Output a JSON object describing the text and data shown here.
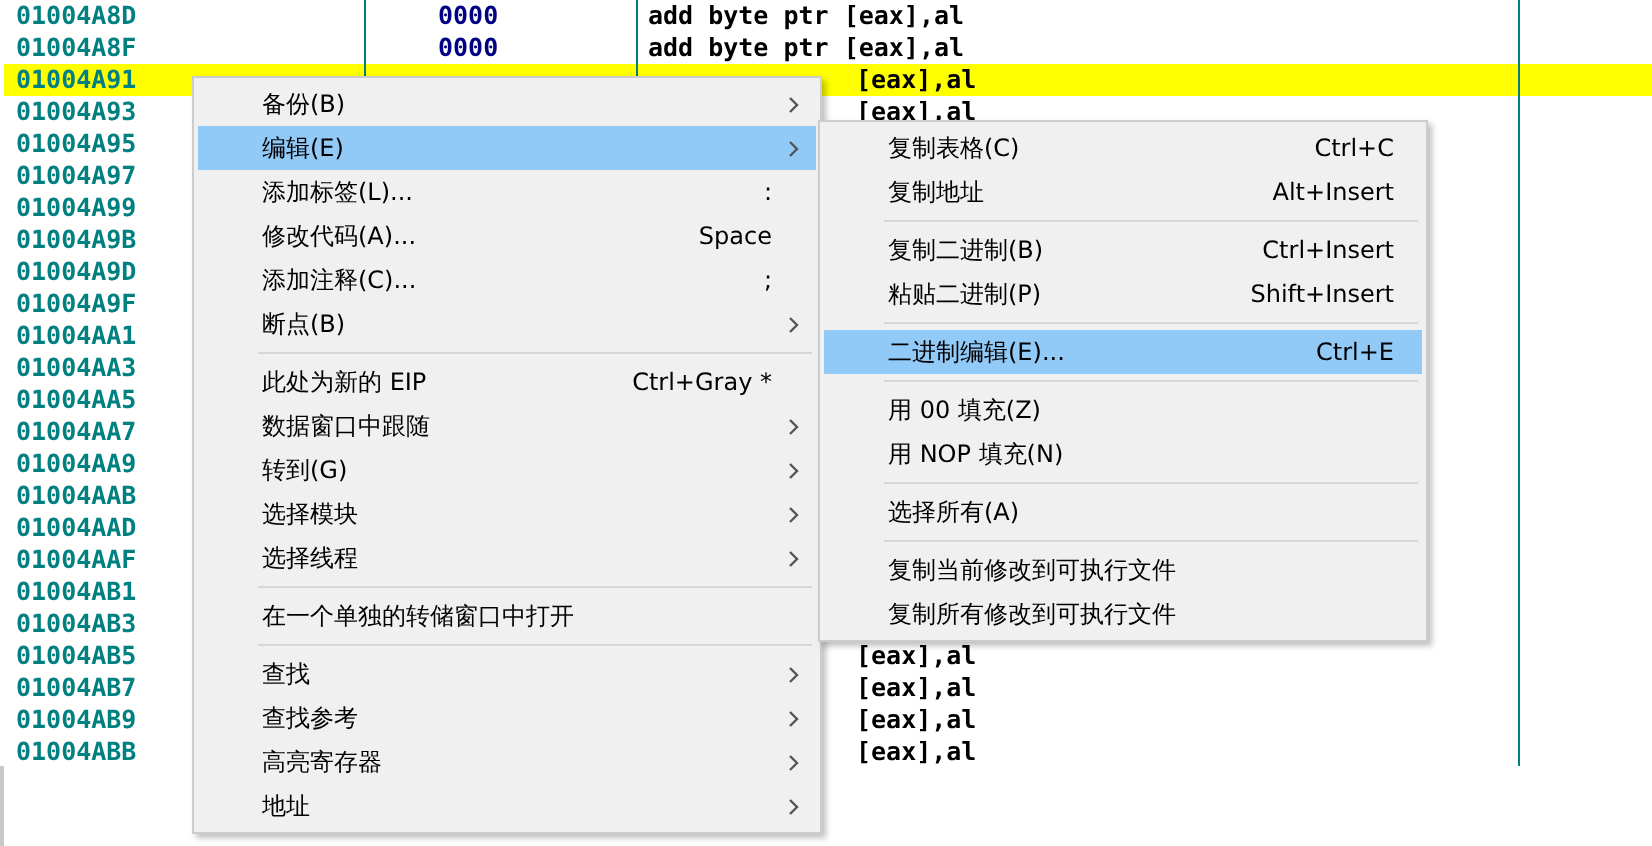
{
  "rows": [
    {
      "address": "01004A8D",
      "hex": "0000",
      "code": "add byte ptr [eax],al",
      "kind": "full",
      "selected": false
    },
    {
      "address": "01004A8F",
      "hex": "0000",
      "code": "add byte ptr [eax],al",
      "kind": "full",
      "selected": false
    },
    {
      "address": "01004A91",
      "code": "[eax],al",
      "kind": "tail",
      "selected": true
    },
    {
      "address": "01004A93",
      "code": "[eax],al",
      "kind": "tail",
      "selected": false
    },
    {
      "address": "01004A95",
      "selected": false
    },
    {
      "address": "01004A97",
      "selected": false
    },
    {
      "address": "01004A99",
      "selected": false
    },
    {
      "address": "01004A9B",
      "selected": false
    },
    {
      "address": "01004A9D",
      "selected": false
    },
    {
      "address": "01004A9F",
      "selected": false
    },
    {
      "address": "01004AA1",
      "selected": false
    },
    {
      "address": "01004AA3",
      "selected": false
    },
    {
      "address": "01004AA5",
      "selected": false
    },
    {
      "address": "01004AA7",
      "selected": false
    },
    {
      "address": "01004AA9",
      "selected": false
    },
    {
      "address": "01004AAB",
      "selected": false
    },
    {
      "address": "01004AAD",
      "selected": false
    },
    {
      "address": "01004AAF",
      "selected": false
    },
    {
      "address": "01004AB1",
      "selected": false
    },
    {
      "address": "01004AB3",
      "selected": false
    },
    {
      "address": "01004AB5",
      "code": "[eax],al",
      "kind": "tail",
      "selected": false
    },
    {
      "address": "01004AB7",
      "code": "[eax],al",
      "kind": "tail",
      "selected": false
    },
    {
      "address": "01004AB9",
      "code": "[eax],al",
      "kind": "tail",
      "selected": false
    },
    {
      "address": "01004ABB",
      "code": "[eax],al",
      "kind": "tail",
      "selected": false
    }
  ],
  "context_menu": [
    {
      "kind": "item",
      "label": "备份(B)",
      "submenu": true,
      "selected": false
    },
    {
      "kind": "item",
      "label": "编辑(E)",
      "submenu": true,
      "selected": true
    },
    {
      "kind": "item",
      "label": "添加标签(L)...",
      "shortcut": ":",
      "submenu": false,
      "selected": false
    },
    {
      "kind": "item",
      "label": "修改代码(A)...",
      "shortcut": "Space",
      "submenu": false,
      "selected": false
    },
    {
      "kind": "item",
      "label": "添加注释(C)...",
      "shortcut": ";",
      "submenu": false,
      "selected": false
    },
    {
      "kind": "item",
      "label": "断点(B)",
      "submenu": true,
      "selected": false
    },
    {
      "kind": "separator"
    },
    {
      "kind": "item",
      "label": "此处为新的 EIP",
      "shortcut": "Ctrl+Gray *",
      "submenu": false,
      "selected": false
    },
    {
      "kind": "item",
      "label": "数据窗口中跟随",
      "submenu": true,
      "selected": false
    },
    {
      "kind": "item",
      "label": "转到(G)",
      "submenu": true,
      "selected": false
    },
    {
      "kind": "item",
      "label": "选择模块",
      "submenu": true,
      "selected": false
    },
    {
      "kind": "item",
      "label": "选择线程",
      "submenu": true,
      "selected": false
    },
    {
      "kind": "separator"
    },
    {
      "kind": "item",
      "label": "在一个单独的转储窗口中打开",
      "submenu": false,
      "selected": false
    },
    {
      "kind": "separator"
    },
    {
      "kind": "item",
      "label": "查找",
      "submenu": true,
      "selected": false
    },
    {
      "kind": "item",
      "label": "查找参考",
      "submenu": true,
      "selected": false
    },
    {
      "kind": "item",
      "label": "高亮寄存器",
      "submenu": true,
      "selected": false
    },
    {
      "kind": "item",
      "label": "地址",
      "submenu": true,
      "selected": false
    }
  ],
  "edit_submenu": [
    {
      "kind": "item",
      "label": "复制表格(C)",
      "shortcut": "Ctrl+C",
      "selected": false
    },
    {
      "kind": "item",
      "label": "复制地址",
      "shortcut": "Alt+Insert",
      "selected": false
    },
    {
      "kind": "separator"
    },
    {
      "kind": "item",
      "label": "复制二进制(B)",
      "shortcut": "Ctrl+Insert",
      "selected": false
    },
    {
      "kind": "item",
      "label": "粘贴二进制(P)",
      "shortcut": "Shift+Insert",
      "selected": false
    },
    {
      "kind": "separator"
    },
    {
      "kind": "item",
      "label": "二进制编辑(E)...",
      "shortcut": "Ctrl+E",
      "selected": true
    },
    {
      "kind": "separator"
    },
    {
      "kind": "item",
      "label": "用 00 填充(Z)",
      "selected": false
    },
    {
      "kind": "item",
      "label": "用 NOP 填充(N)",
      "selected": false
    },
    {
      "kind": "separator"
    },
    {
      "kind": "item",
      "label": "选择所有(A)",
      "selected": false
    },
    {
      "kind": "separator"
    },
    {
      "kind": "item",
      "label": "复制当前修改到可执行文件",
      "selected": false
    },
    {
      "kind": "item",
      "label": "复制所有修改到可执行文件",
      "selected": false
    }
  ]
}
